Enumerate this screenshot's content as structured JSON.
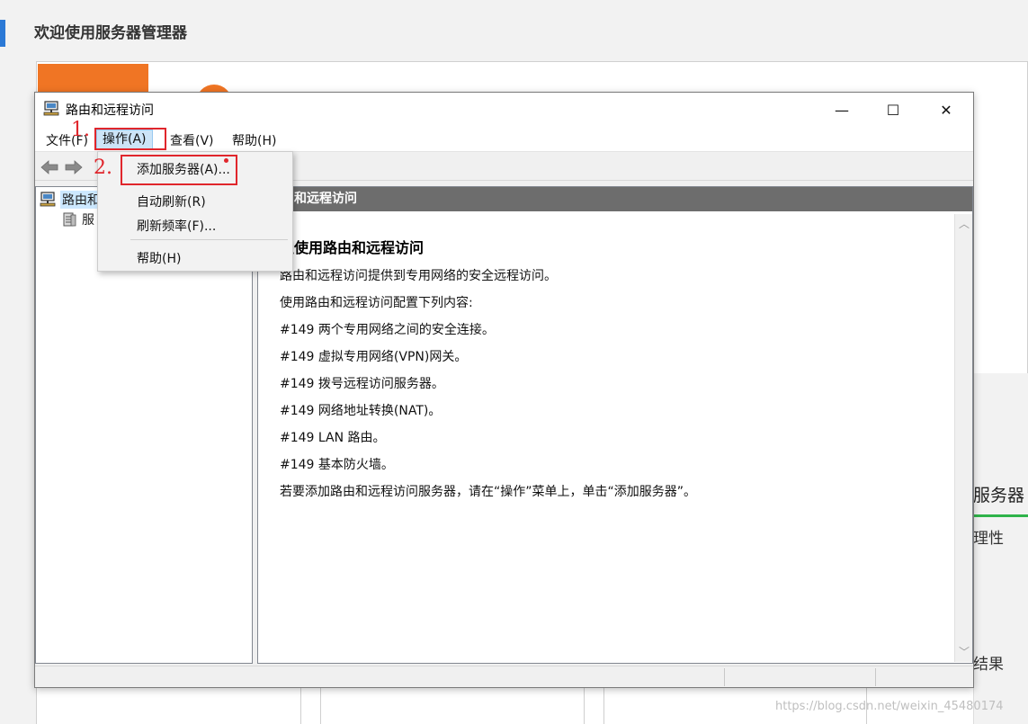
{
  "background": {
    "title": "欢迎使用服务器管理器",
    "right_title": "服务器",
    "right_item_1": "理性",
    "right_item_2": "结果",
    "watermark": "https://blog.csdn.net/weixin_45480174",
    "accent_color": "#f07524"
  },
  "window": {
    "title": "路由和远程访问",
    "title_icon": "routing-console-icon",
    "controls": {
      "minimize": "—",
      "maximize": "☐",
      "close": "✕"
    },
    "menu": [
      {
        "label": "文件(F)"
      },
      {
        "label": "操作(A)"
      },
      {
        "label": "查看(V)"
      },
      {
        "label": "帮助(H)"
      }
    ],
    "toolbar": {
      "back_icon": "back-arrow-icon",
      "forward_icon": "forward-arrow-icon"
    },
    "tree": {
      "root_label": "路由和",
      "child_label": "服"
    },
    "main": {
      "header": "和远程访问",
      "heading": "迎使用路由和远程访问",
      "paragraphs": [
        "路由和远程访问提供到专用网络的安全远程访问。",
        "使用路由和远程访问配置下列内容:",
        "#149 两个专用网络之间的安全连接。",
        "#149 虚拟专用网络(VPN)网关。",
        "#149 拨号远程访问服务器。",
        "#149 网络地址转换(NAT)。",
        "#149 LAN 路由。",
        "#149 基本防火墙。",
        "若要添加路由和远程访问服务器，请在“操作”菜单上，单击“添加服务器”。"
      ]
    }
  },
  "dropdown": {
    "items": [
      {
        "label": "添加服务器(A)..."
      },
      {
        "label": "自动刷新(R)"
      },
      {
        "label": "刷新频率(F)..."
      },
      {
        "label": "帮助(H)"
      }
    ]
  },
  "annotations": {
    "step1": "1.",
    "step2": "2.",
    "color": "#e0262c"
  }
}
